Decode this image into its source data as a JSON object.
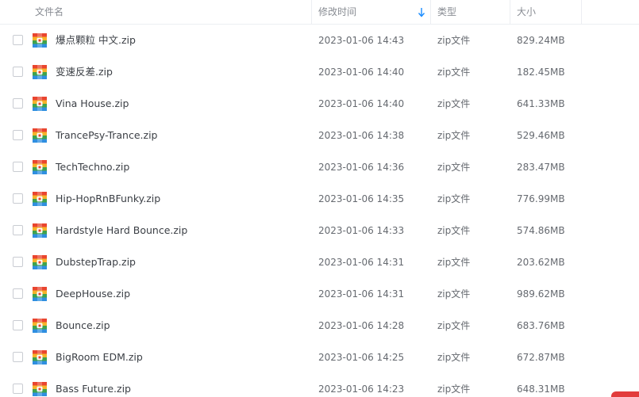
{
  "header": {
    "name_label": "文件名",
    "date_label": "修改时间",
    "type_label": "类型",
    "size_label": "大小"
  },
  "colors": {
    "sort_arrow": "#1a8cff",
    "icon_book": [
      "#e9452f",
      "#f6b32a",
      "#3fa34d",
      "#2f8fe0"
    ]
  },
  "files": [
    {
      "name": "爆点颗粒 中文.zip",
      "date": "2023-01-06 14:43",
      "type": "zip文件",
      "size": "829.24MB"
    },
    {
      "name": "变速反差.zip",
      "date": "2023-01-06 14:40",
      "type": "zip文件",
      "size": "182.45MB"
    },
    {
      "name": "Vina House.zip",
      "date": "2023-01-06 14:40",
      "type": "zip文件",
      "size": "641.33MB"
    },
    {
      "name": "TrancePsy-Trance.zip",
      "date": "2023-01-06 14:38",
      "type": "zip文件",
      "size": "529.46MB"
    },
    {
      "name": "TechTechno.zip",
      "date": "2023-01-06 14:36",
      "type": "zip文件",
      "size": "283.47MB"
    },
    {
      "name": "Hip-HopRnBFunky.zip",
      "date": "2023-01-06 14:35",
      "type": "zip文件",
      "size": "776.99MB"
    },
    {
      "name": "Hardstyle Hard Bounce.zip",
      "date": "2023-01-06 14:33",
      "type": "zip文件",
      "size": "574.86MB"
    },
    {
      "name": "DubstepTrap.zip",
      "date": "2023-01-06 14:31",
      "type": "zip文件",
      "size": "203.62MB"
    },
    {
      "name": "DeepHouse.zip",
      "date": "2023-01-06 14:31",
      "type": "zip文件",
      "size": "989.62MB"
    },
    {
      "name": "Bounce.zip",
      "date": "2023-01-06 14:28",
      "type": "zip文件",
      "size": "683.76MB"
    },
    {
      "name": "BigRoom EDM.zip",
      "date": "2023-01-06 14:25",
      "type": "zip文件",
      "size": "672.87MB"
    },
    {
      "name": "Bass Future.zip",
      "date": "2023-01-06 14:23",
      "type": "zip文件",
      "size": "648.31MB"
    }
  ]
}
